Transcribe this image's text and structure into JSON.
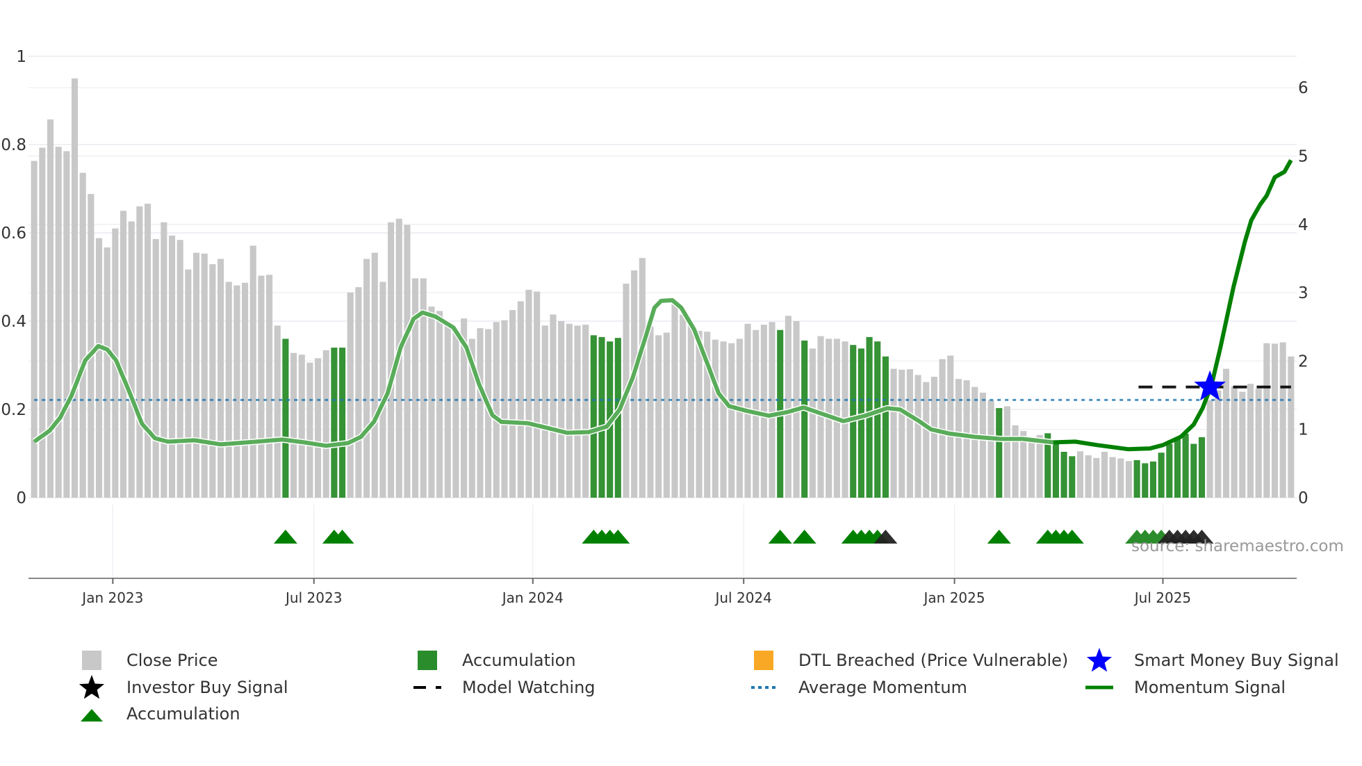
{
  "chart_data": {
    "type": "bar",
    "title": "",
    "source_note": "source: sharemaestro.com",
    "left_axis": {
      "ylim": [
        0,
        1
      ],
      "ticks": [
        "0",
        "0.2",
        "0.4",
        "0.6",
        "0.8",
        "1"
      ],
      "tick_values": [
        0,
        0.2,
        0.4,
        0.6,
        0.8,
        1
      ]
    },
    "right_axis": {
      "ylim": [
        0,
        6.46
      ],
      "ticks": [
        "0",
        "1",
        "2",
        "3",
        "4",
        "5",
        "6"
      ],
      "tick_values": [
        0,
        1,
        2,
        3,
        4,
        5,
        6
      ]
    },
    "x_axis": {
      "unit": "week index",
      "range": [
        -0.7,
        155.7
      ],
      "ticks": [
        {
          "label": "Jan 2023",
          "week": 9.7
        },
        {
          "label": "Jul 2023",
          "week": 34.5
        },
        {
          "label": "Jan 2024",
          "week": 61.5
        },
        {
          "label": "Jul 2024",
          "week": 87.5
        },
        {
          "label": "Jan 2025",
          "week": 113.5
        },
        {
          "label": "Jul 2025",
          "week": 139.2
        }
      ]
    },
    "close_price": [
      0.763,
      0.793,
      0.857,
      0.795,
      0.785,
      0.95,
      0.736,
      0.688,
      0.588,
      0.567,
      0.61,
      0.65,
      0.626,
      0.66,
      0.666,
      0.586,
      0.624,
      0.594,
      0.584,
      0.517,
      0.555,
      0.553,
      0.529,
      0.541,
      0.489,
      0.481,
      0.487,
      0.571,
      0.503,
      0.505,
      0.39,
      0.36,
      0.328,
      0.324,
      0.306,
      0.316,
      0.334,
      0.34,
      0.34,
      0.465,
      0.477,
      0.541,
      0.555,
      0.489,
      0.624,
      0.632,
      0.618,
      0.497,
      0.497,
      0.433,
      0.423,
      0.392,
      0.376,
      0.406,
      0.36,
      0.384,
      0.382,
      0.398,
      0.402,
      0.425,
      0.445,
      0.471,
      0.467,
      0.39,
      0.415,
      0.4,
      0.394,
      0.39,
      0.392,
      0.368,
      0.364,
      0.354,
      0.362,
      0.485,
      0.515,
      0.543,
      0.388,
      0.368,
      0.374,
      0.443,
      0.415,
      0.39,
      0.378,
      0.376,
      0.358,
      0.354,
      0.35,
      0.36,
      0.394,
      0.38,
      0.392,
      0.398,
      0.38,
      0.412,
      0.4,
      0.356,
      0.338,
      0.366,
      0.36,
      0.36,
      0.354,
      0.346,
      0.338,
      0.364,
      0.354,
      0.32,
      0.292,
      0.29,
      0.291,
      0.278,
      0.262,
      0.274,
      0.314,
      0.322,
      0.269,
      0.266,
      0.251,
      0.238,
      0.221,
      0.203,
      0.207,
      0.164,
      0.151,
      0.133,
      0.142,
      0.146,
      0.129,
      0.104,
      0.094,
      0.105,
      0.096,
      0.09,
      0.104,
      0.092,
      0.089,
      0.083,
      0.085,
      0.078,
      0.082,
      0.102,
      0.122,
      0.132,
      0.145,
      0.122,
      0.137,
      0.221,
      0.243,
      0.292,
      0.252,
      0.24,
      0.258,
      0.247,
      0.35,
      0.349,
      0.352,
      0.32
    ],
    "accumulation_weeks": [
      31,
      37,
      38,
      69,
      70,
      71,
      72,
      92,
      95,
      101,
      102,
      103,
      104,
      105,
      119,
      125,
      126,
      127,
      128,
      136,
      137,
      138,
      139,
      140,
      141,
      142,
      143,
      144
    ],
    "accumulation_triangles": [
      31,
      37,
      38,
      69,
      70,
      71,
      72,
      92,
      95,
      101,
      102,
      103,
      104,
      119,
      125,
      126,
      127,
      128,
      136,
      137,
      138,
      139
    ],
    "investor_buy_triangles": [
      105,
      140,
      141,
      142,
      143,
      144
    ],
    "momentum_signal": [
      [
        0,
        0.82
      ],
      [
        1.9,
        0.98
      ],
      [
        3.2,
        1.17
      ],
      [
        4.6,
        1.49
      ],
      [
        6.3,
        2.01
      ],
      [
        7.9,
        2.22
      ],
      [
        9,
        2.17
      ],
      [
        10.1,
        2.01
      ],
      [
        11.7,
        1.56
      ],
      [
        13.3,
        1.08
      ],
      [
        14.9,
        0.87
      ],
      [
        16.5,
        0.82
      ],
      [
        19.8,
        0.84
      ],
      [
        23,
        0.78
      ],
      [
        26.3,
        0.81
      ],
      [
        30.6,
        0.85
      ],
      [
        33.3,
        0.81
      ],
      [
        36,
        0.76
      ],
      [
        38.7,
        0.8
      ],
      [
        40.3,
        0.89
      ],
      [
        41.9,
        1.11
      ],
      [
        43.6,
        1.53
      ],
      [
        45.2,
        2.2
      ],
      [
        46.8,
        2.62
      ],
      [
        47.9,
        2.71
      ],
      [
        49.5,
        2.65
      ],
      [
        51.7,
        2.49
      ],
      [
        53.3,
        2.2
      ],
      [
        54.9,
        1.65
      ],
      [
        56.5,
        1.21
      ],
      [
        57.6,
        1.11
      ],
      [
        60.9,
        1.09
      ],
      [
        63,
        1.03
      ],
      [
        65.7,
        0.95
      ],
      [
        68.4,
        0.96
      ],
      [
        70.6,
        1.04
      ],
      [
        72.2,
        1.29
      ],
      [
        73.8,
        1.75
      ],
      [
        75.5,
        2.39
      ],
      [
        76.5,
        2.78
      ],
      [
        77.3,
        2.88
      ],
      [
        78.7,
        2.89
      ],
      [
        79.8,
        2.78
      ],
      [
        81.4,
        2.46
      ],
      [
        83,
        1.97
      ],
      [
        84.4,
        1.53
      ],
      [
        85.7,
        1.34
      ],
      [
        87.9,
        1.27
      ],
      [
        90.6,
        1.2
      ],
      [
        92.8,
        1.25
      ],
      [
        94.9,
        1.32
      ],
      [
        97.1,
        1.23
      ],
      [
        99.8,
        1.12
      ],
      [
        102.5,
        1.2
      ],
      [
        105.2,
        1.31
      ],
      [
        106.8,
        1.29
      ],
      [
        109,
        1.13
      ],
      [
        110.6,
        1.0
      ],
      [
        112.8,
        0.94
      ],
      [
        116,
        0.89
      ],
      [
        119.2,
        0.86
      ],
      [
        121.9,
        0.86
      ],
      [
        125.7,
        0.81
      ],
      [
        128.4,
        0.82
      ],
      [
        131.1,
        0.77
      ],
      [
        134.9,
        0.71
      ],
      [
        137.6,
        0.72
      ],
      [
        139.2,
        0.77
      ],
      [
        141.4,
        0.89
      ],
      [
        143,
        1.07
      ],
      [
        144.1,
        1.31
      ],
      [
        145.2,
        1.65
      ],
      [
        146.3,
        2.2
      ],
      [
        147.9,
        3.08
      ],
      [
        149.3,
        3.74
      ],
      [
        150.1,
        4.06
      ],
      [
        151.2,
        4.29
      ],
      [
        152,
        4.42
      ],
      [
        153,
        4.69
      ],
      [
        154.2,
        4.77
      ],
      [
        155,
        4.94
      ]
    ],
    "momentum_solid_from_week": 126,
    "average_momentum": 1.43,
    "model_watching": {
      "value": 1.62,
      "from_week": 136.2,
      "to_week": 155
    },
    "smart_money_buy_signal": {
      "week": 145,
      "value": 1.62
    },
    "legend": [
      {
        "label": "Close Price",
        "icon": "gray-square"
      },
      {
        "label": "Accumulation",
        "icon": "green-square"
      },
      {
        "label": "DTL Breached (Price Vulnerable)",
        "icon": "orange-square"
      },
      {
        "label": "Smart Money Buy Signal",
        "icon": "blue-star"
      },
      {
        "label": "Investor Buy Signal",
        "icon": "black-star"
      },
      {
        "label": "Model Watching",
        "icon": "black-dashed-line"
      },
      {
        "label": "Average Momentum",
        "icon": "blue-dotted-line"
      },
      {
        "label": "Momentum Signal",
        "icon": "green-line"
      },
      {
        "label": "Accumulation",
        "icon": "green-triangle"
      }
    ],
    "legend_placement": "bottom"
  },
  "colors": {
    "close_price": "#c8c8c8",
    "accumulation": "#2a8c2a",
    "dtl": "#f9a825",
    "smart_money": "#0000ff",
    "investor": "#000000",
    "momentum": "#008000",
    "average": "#1f77b4"
  }
}
